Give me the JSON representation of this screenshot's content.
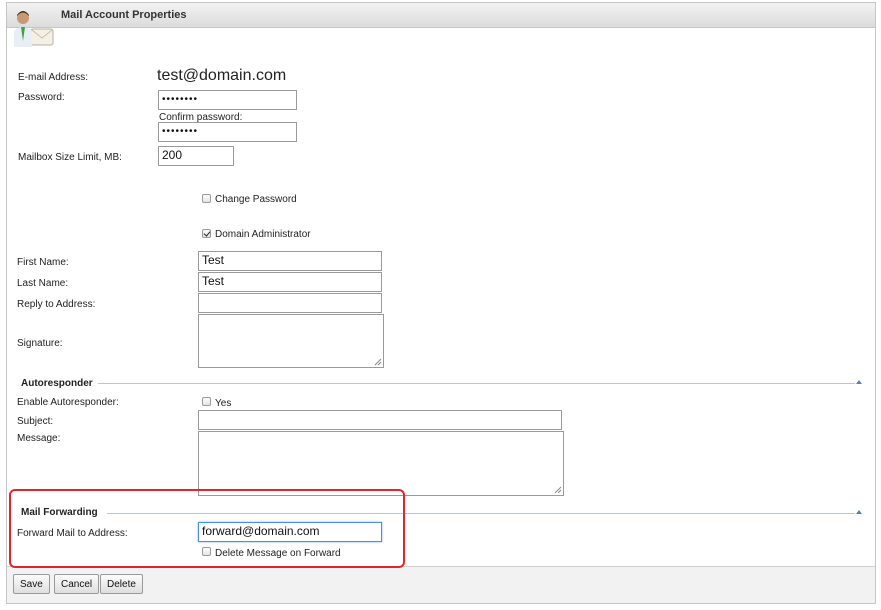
{
  "window": {
    "title": "Mail Account Properties"
  },
  "account": {
    "email_label": "E-mail Address:",
    "email_value": "test@domain.com",
    "password_label": "Password:",
    "password_value": "••••••••",
    "confirm_label": "Confirm password:",
    "confirm_value": "••••••••",
    "mailbox_label": "Mailbox Size Limit, MB:",
    "mailbox_value": "200",
    "change_password_label": "Change Password",
    "change_password_checked": false,
    "domain_admin_label": "Domain Administrator",
    "domain_admin_checked": true,
    "first_name_label": "First Name:",
    "first_name_value": "Test",
    "last_name_label": "Last Name:",
    "last_name_value": "Test",
    "reply_to_label": "Reply to Address:",
    "reply_to_value": "",
    "signature_label": "Signature:",
    "signature_value": ""
  },
  "autoresponder": {
    "section_label": "Autoresponder",
    "enable_label": "Enable Autoresponder:",
    "yes_label": "Yes",
    "enabled": false,
    "subject_label": "Subject:",
    "subject_value": "",
    "message_label": "Message:",
    "message_value": ""
  },
  "forwarding": {
    "section_label": "Mail Forwarding",
    "forward_label": "Forward Mail to Address:",
    "forward_value": "forward@domain.com",
    "delete_label": "Delete Message on Forward",
    "delete_checked": false
  },
  "footer": {
    "save_label": "Save",
    "cancel_label": "Cancel",
    "delete_label": "Delete"
  },
  "colors": {
    "highlight": "#e0262a",
    "section_line": "#b9c5da",
    "focus": "#4a8ee8"
  }
}
